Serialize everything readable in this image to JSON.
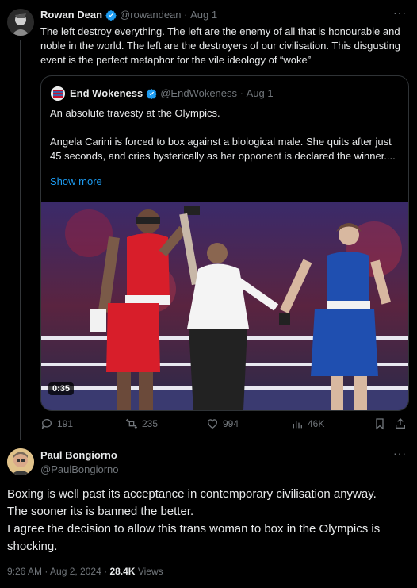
{
  "post": {
    "author_name": "Rowan Dean",
    "handle": "@rowandean",
    "date": "Aug 1",
    "text": "The left destroy everything. The left are the enemy of all that is honourable and noble in the world. The left are the destroyers of our civilisation. This disgusting event is the perfect metaphor for the vile ideology of “woke”",
    "more_icon": "more-icon"
  },
  "quote": {
    "author_name": "End Wokeness",
    "handle": "@EndWokeness",
    "date": "Aug 1",
    "line1": "An absolute travesty at the Olympics.",
    "line2": "Angela Carini is forced to box against a biological male. She quits after just 45 seconds, and cries hysterically as her opponent is declared the winner....",
    "show_more": "Show more",
    "video_time": "0:35"
  },
  "actions": {
    "replies": "191",
    "reposts": "235",
    "likes": "994",
    "views": "46K"
  },
  "reply": {
    "author_name": "Paul Bongiorno",
    "handle": "@PaulBongiorno",
    "line1": "Boxing is well past its acceptance in contemporary civilisation anyway.",
    "line2": "The sooner its is banned the better.",
    "line3": "I agree the decision to allow this trans woman to box in the Olympics is shocking.",
    "time": "9:26 AM · Aug 2, 2024 ·",
    "views_count": "28.4K",
    "views_label": "Views"
  }
}
